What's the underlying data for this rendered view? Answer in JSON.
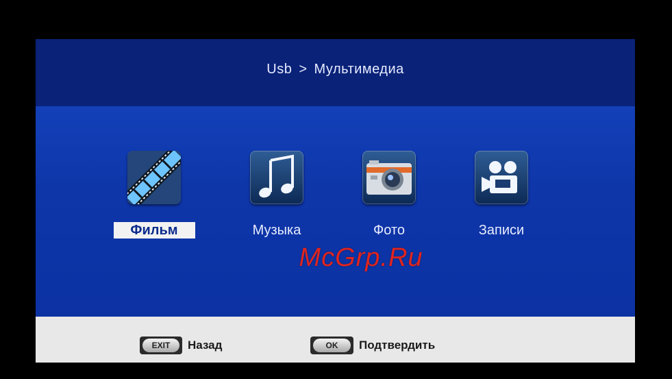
{
  "header": {
    "breadcrumb_root": "Usb",
    "breadcrumb_separator": ">",
    "breadcrumb_current": "Мультимедиа"
  },
  "menu": {
    "items": [
      {
        "label": "Фильм",
        "icon": "film-strip-icon",
        "selected": true
      },
      {
        "label": "Музыка",
        "icon": "music-note-icon",
        "selected": false
      },
      {
        "label": "Фото",
        "icon": "camera-icon",
        "selected": false
      },
      {
        "label": "Записи",
        "icon": "video-camera-icon",
        "selected": false
      }
    ]
  },
  "watermark": "McGrp.Ru",
  "footer": {
    "exit_key": "EXIT",
    "exit_label": "Назад",
    "ok_key": "OK",
    "ok_label": "Подтвердить"
  },
  "colors": {
    "header_bg": "#0a2278",
    "content_bg": "#0f35a8",
    "footer_bg": "#e8e8e8",
    "selected_bg": "#f2f2f2",
    "watermark": "#e0241f"
  }
}
